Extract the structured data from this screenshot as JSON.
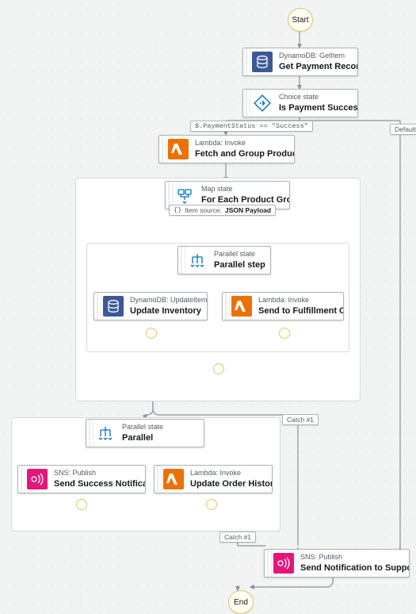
{
  "terminals": {
    "start_label": "Start",
    "end_label": "End"
  },
  "labels": {
    "rule_payment_success": "$.PaymentStatus == \"Success\"",
    "rule_default": "Default",
    "item_source_prefix": "Item source:",
    "item_source_value": "JSON Payload",
    "catch1": "Catch #1"
  },
  "nodes": {
    "get_payment": {
      "sub": "DynamoDB: GetItem",
      "title": "Get Payment Record"
    },
    "is_success": {
      "sub": "Choice state",
      "title": "Is Payment Success?"
    },
    "fetch_group": {
      "sub": "Lambda: Invoke",
      "title": "Fetch and Group Products"
    },
    "map_each": {
      "sub": "Map state",
      "title": "For Each Product Group"
    },
    "parallel_step": {
      "sub": "Parallel state",
      "title": "Parallel step"
    },
    "update_inv": {
      "sub": "DynamoDB: UpdateItem",
      "title": "Update Inventory"
    },
    "send_fulfill": {
      "sub": "Lambda: Invoke",
      "title": "Send to Fulfillment Center"
    },
    "parallel2": {
      "sub": "Parallel state",
      "title": "Parallel"
    },
    "send_success": {
      "sub": "SNS: Publish",
      "title": "Send Success Notification"
    },
    "update_hist": {
      "sub": "Lambda: Invoke",
      "title": "Update Order History"
    },
    "send_support": {
      "sub": "SNS: Publish",
      "title": "Send Notification to Support Team"
    }
  }
}
